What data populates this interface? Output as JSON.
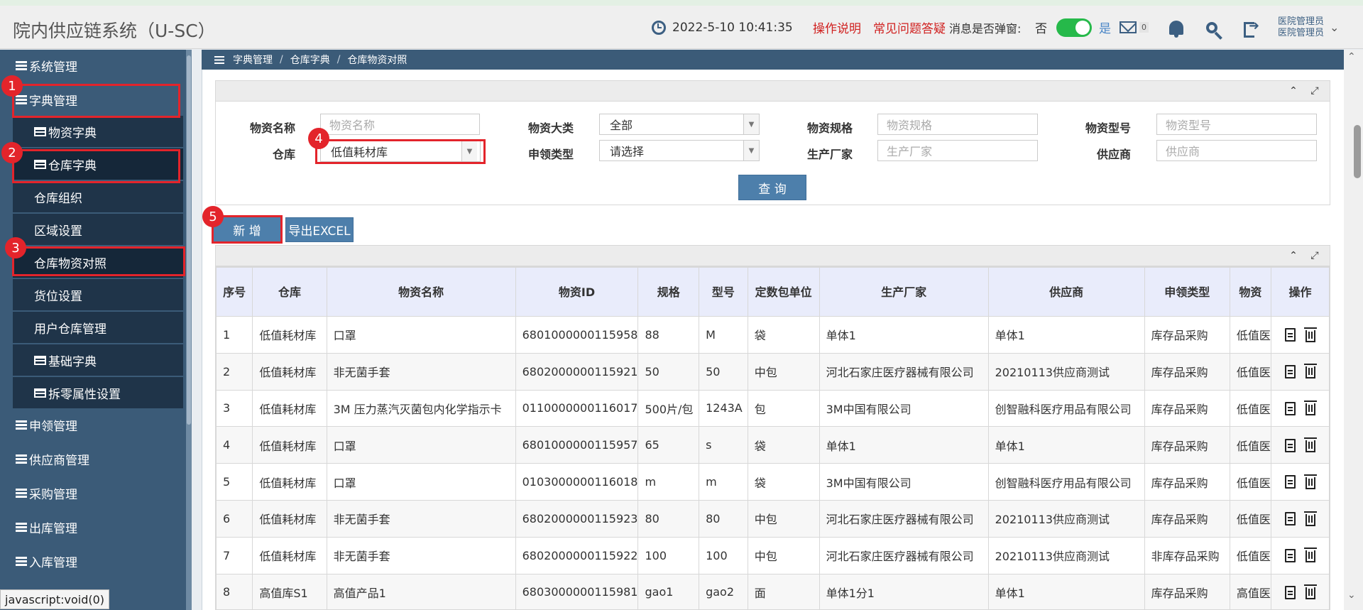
{
  "app": {
    "title": "院内供应链系统（U-SC）"
  },
  "header": {
    "datetime": "2022-5-10  10:41:35",
    "help_link": "操作说明",
    "faq_link": "常见问题答疑",
    "popup_label": "消息是否弹窗:",
    "popup_no": "否",
    "popup_yes": "是",
    "mail_count": "0",
    "user_line1": "医院管理员",
    "user_line2": "医院管理员",
    "toggle_color": "#26b94a"
  },
  "sidebar": {
    "items": [
      {
        "label": "系统管理"
      },
      {
        "label": "字典管理"
      },
      {
        "label": "物资字典"
      },
      {
        "label": "仓库字典"
      },
      {
        "label": "仓库组织"
      },
      {
        "label": "区域设置"
      },
      {
        "label": "仓库物资对照"
      },
      {
        "label": "货位设置"
      },
      {
        "label": "用户仓库管理"
      },
      {
        "label": "基础字典"
      },
      {
        "label": "拆零属性设置"
      },
      {
        "label": "申领管理"
      },
      {
        "label": "供应商管理"
      },
      {
        "label": "采购管理"
      },
      {
        "label": "出库管理"
      },
      {
        "label": "入库管理"
      }
    ]
  },
  "steps": [
    "1",
    "2",
    "3",
    "4",
    "5"
  ],
  "status_tip": "javascript:void(0)",
  "breadcrumb": [
    "字典管理",
    "仓库字典",
    "仓库物资对照"
  ],
  "search": {
    "labels": {
      "name": "物资名称",
      "category": "物资大类",
      "spec": "物资规格",
      "model": "物资型号",
      "warehouse": "仓库",
      "apply_type": "申领类型",
      "maker": "生产厂家",
      "supplier": "供应商"
    },
    "placeholders": {
      "name": "物资名称",
      "spec": "物资规格",
      "model": "物资型号",
      "maker": "生产厂家",
      "supplier": "供应商"
    },
    "values": {
      "category": "全部",
      "warehouse": "低值耗材库",
      "apply_type": "请选择"
    },
    "query_button": "查 询"
  },
  "toolbar": {
    "add_button": "新 增",
    "export_button": "导出EXCEL"
  },
  "table": {
    "headers": [
      "序号",
      "仓库",
      "物资名称",
      "物资ID",
      "规格",
      "型号",
      "定数包单位",
      "生产厂家",
      "供应商",
      "申领类型",
      "物资",
      "操作"
    ],
    "rows": [
      [
        "1",
        "低值耗材库",
        "口罩",
        "6801000000115958",
        "88",
        "M",
        "袋",
        "单体1",
        "单体1",
        "库存品采购",
        "低值医"
      ],
      [
        "2",
        "低值耗材库",
        "非无菌手套",
        "6802000000115921",
        "50",
        "50",
        "中包",
        "河北石家庄医疗器械有限公司",
        "20210113供应商测试",
        "库存品采购",
        "低值医"
      ],
      [
        "3",
        "低值耗材库",
        "3M 压力蒸汽灭菌包内化学指示卡",
        "0110000000116017",
        "500片/包",
        "1243A",
        "包",
        "3M中国有限公司",
        "创智融科医疗用品有限公司",
        "库存品采购",
        "低值医"
      ],
      [
        "4",
        "低值耗材库",
        "口罩",
        "6801000000115957",
        "65",
        "s",
        "袋",
        "单体1",
        "单体1",
        "库存品采购",
        "低值医"
      ],
      [
        "5",
        "低值耗材库",
        "口罩",
        "0103000000116018",
        "m",
        "m",
        "袋",
        "3M中国有限公司",
        "创智融科医疗用品有限公司",
        "库存品采购",
        "低值医"
      ],
      [
        "6",
        "低值耗材库",
        "非无菌手套",
        "6802000000115923",
        "80",
        "80",
        "中包",
        "河北石家庄医疗器械有限公司",
        "20210113供应商测试",
        "库存品采购",
        "低值医"
      ],
      [
        "7",
        "低值耗材库",
        "非无菌手套",
        "6802000000115922",
        "100",
        "100",
        "中包",
        "河北石家庄医疗器械有限公司",
        "20210113供应商测试",
        "非库存品采购",
        "低值医"
      ],
      [
        "8",
        "高值库S1",
        "高值产品1",
        "6803000000115981",
        "gao1",
        "gao2",
        "面",
        "单体1分1",
        "单体1",
        "库存品采购",
        "高值医"
      ]
    ]
  },
  "colors": {
    "sidebar": "#3b5b78",
    "highlight": "#e3242b",
    "accent_button": "#4d7fab",
    "danger_link": "#d0201f"
  }
}
